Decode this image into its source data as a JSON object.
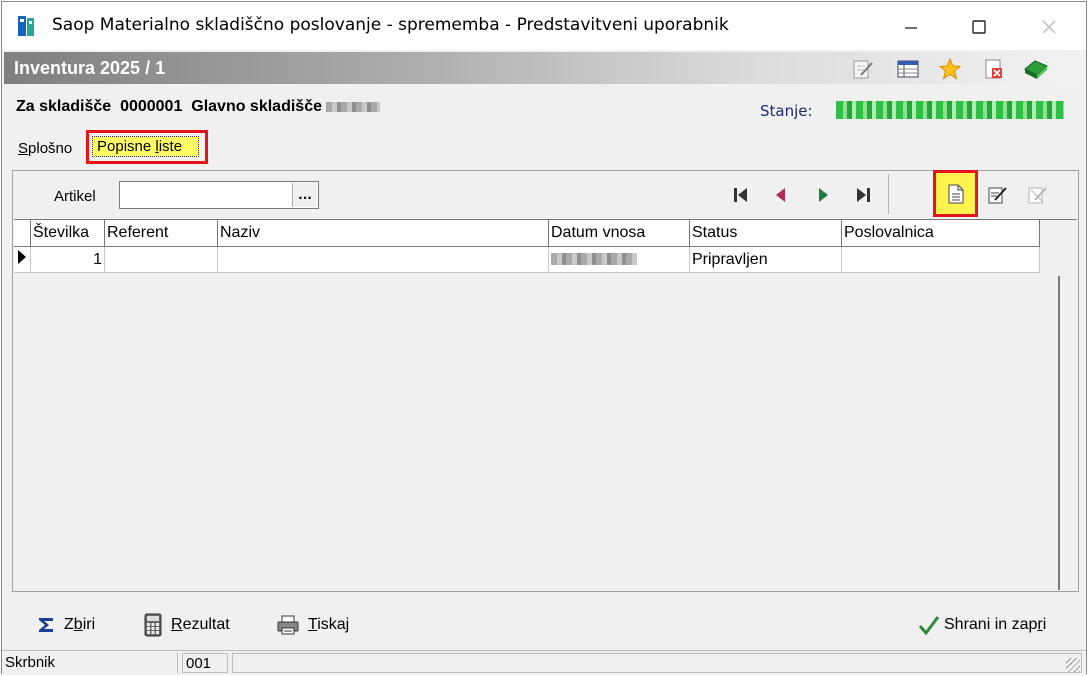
{
  "window": {
    "title": "Saop Materialno skladiščno poslovanje - sprememba - Predstavitveni uporabnik",
    "minimize_icon": "minimize-icon",
    "maximize_icon": "maximize-icon",
    "close_icon": "close-icon"
  },
  "band": {
    "title": "Inventura 2025 / 1",
    "icons": [
      "edit-note-icon",
      "table-list-icon",
      "star-icon",
      "delete-document-icon",
      "green-book-icon"
    ]
  },
  "header": {
    "warehouse_label": "Za skladišče",
    "warehouse_code": "0000001",
    "warehouse_name": "Glavno skladišče",
    "state_label": "Stanje:"
  },
  "tabs": [
    {
      "label": "Splošno",
      "accel": "S",
      "rest": "plošno",
      "active": false
    },
    {
      "label": "Popisne liste",
      "before": "Popisne ",
      "accel": "l",
      "rest": "iste",
      "active": true
    }
  ],
  "filter": {
    "artikel_label": "Artikel",
    "artikel_value": "",
    "lookup_label": "..."
  },
  "toolbar": {
    "nav_icons": [
      "first-record-icon",
      "previous-record-icon",
      "next-record-icon",
      "last-record-icon"
    ],
    "action_icons": [
      "new-document-icon",
      "edit-document-icon",
      "delete-document-icon"
    ]
  },
  "grid": {
    "columns": [
      "Številka",
      "Referent",
      "Naziv",
      "Datum vnosa",
      "Status",
      "Poslovalnica"
    ],
    "rows": [
      {
        "stevilka": "1",
        "referent": "",
        "naziv": "",
        "datum_vnosa": "",
        "status": "Pripravljen",
        "poslovalnica": ""
      }
    ]
  },
  "bottom": {
    "zbiri": {
      "before": "Z",
      "accel": "b",
      "after": "iri"
    },
    "rezultat": {
      "before": "",
      "accel": "R",
      "after": "ezultat"
    },
    "tiskaj": {
      "before": "",
      "accel": "T",
      "after": "iskaj"
    },
    "shrani": {
      "before": "Shrani in zap",
      "accel": "r",
      "after": "i"
    }
  },
  "statusbar": {
    "user": "Skrbnik",
    "code": "001",
    "info": ""
  },
  "colors": {
    "highlight_border": "#e3141a",
    "highlight_fill": "#ffff66",
    "state_value": "#2fbf47",
    "state_label": "#1b2a6b"
  }
}
